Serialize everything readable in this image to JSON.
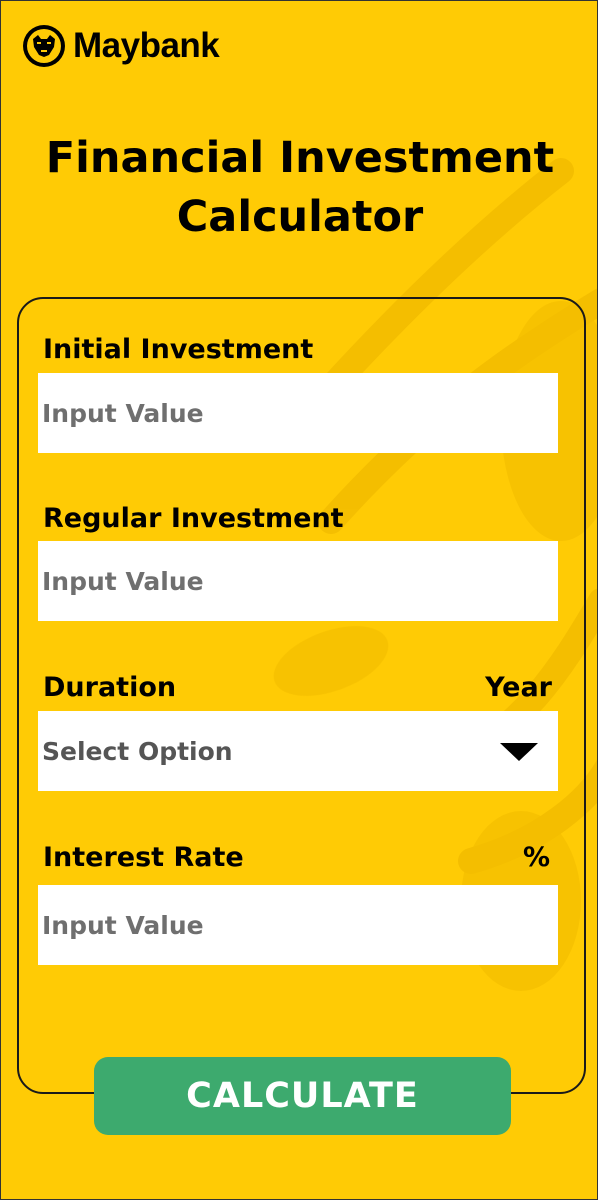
{
  "brand": {
    "name": "Maybank"
  },
  "title": {
    "line1": "Financial Investment",
    "line2": "Calculator"
  },
  "form": {
    "initial_investment": {
      "label": "Initial Investment",
      "placeholder": "Input Value"
    },
    "regular_investment": {
      "label": "Regular Investment",
      "placeholder": "Input Value"
    },
    "duration": {
      "label": "Duration",
      "unit": "Year",
      "placeholder": "Select Option"
    },
    "interest_rate": {
      "label": "Interest Rate",
      "unit": "%",
      "placeholder": "Input Value"
    }
  },
  "actions": {
    "calculate_label": "CALCULATE"
  },
  "colors": {
    "background": "#FFCB05",
    "button": "#3DAA6E",
    "text": "#000000"
  },
  "icons": {
    "logo": "maybank-tiger-icon",
    "dropdown": "triangle-down-icon"
  }
}
